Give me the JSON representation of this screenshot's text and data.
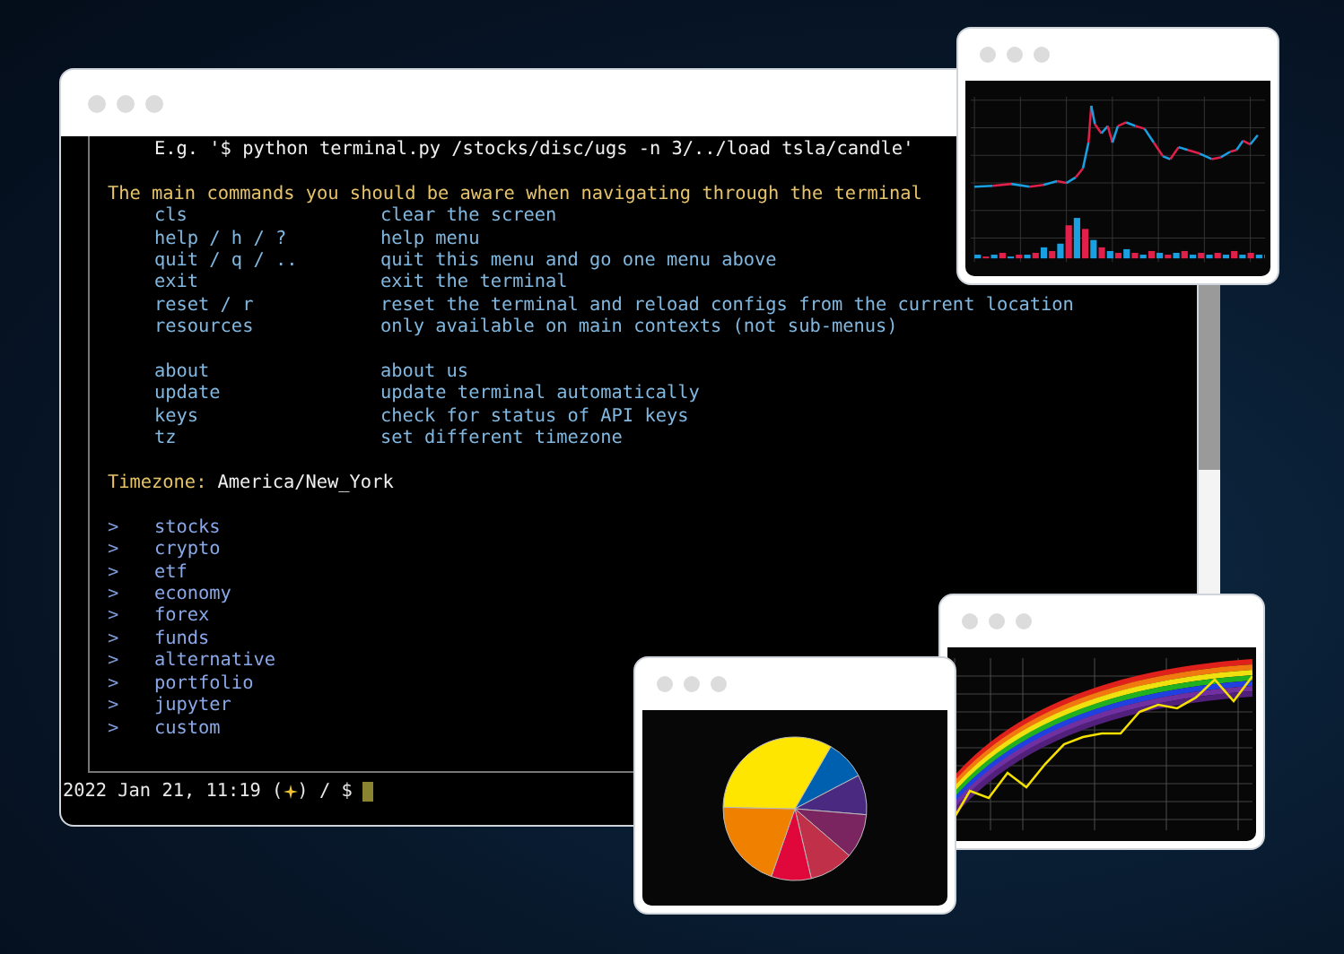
{
  "terminal": {
    "example": "E.g. '$ python terminal.py /stocks/disc/ugs -n 3/../load tsla/candle'",
    "commands_heading": "The main commands you should be aware when navigating through the terminal",
    "command_groups": [
      [
        {
          "command": "cls",
          "description": "clear the screen"
        },
        {
          "command": "help / h / ?",
          "description": "help menu"
        },
        {
          "command": "quit / q / ..",
          "description": "quit this menu and go one menu above"
        },
        {
          "command": "exit",
          "description": "exit the terminal"
        },
        {
          "command": "reset / r",
          "description": "reset the terminal and reload configs from the current location"
        },
        {
          "command": "resources",
          "description": "only available on main contexts (not sub-menus)"
        }
      ],
      [
        {
          "command": "about",
          "description": "about us"
        },
        {
          "command": "update",
          "description": "update terminal automatically"
        },
        {
          "command": "keys",
          "description": "check for status of API keys"
        },
        {
          "command": "tz",
          "description": "set different timezone"
        }
      ]
    ],
    "timezone": {
      "label": "Timezone:",
      "value": "America/New_York"
    },
    "menus": [
      {
        "marker": ">",
        "name": "stocks"
      },
      {
        "marker": ">",
        "name": "crypto"
      },
      {
        "marker": ">",
        "name": "etf"
      },
      {
        "marker": ">",
        "name": "economy"
      },
      {
        "marker": ">",
        "name": "forex"
      },
      {
        "marker": ">",
        "name": "funds"
      },
      {
        "marker": ">",
        "name": "alternative"
      },
      {
        "marker": ">",
        "name": "portfolio"
      },
      {
        "marker": ">",
        "name": "jupyter"
      },
      {
        "marker": ">",
        "name": "custom"
      }
    ],
    "prompt": {
      "before": "2022 Jan 21, 11:19 (",
      "after": ") / $"
    }
  },
  "chart_windows": [
    {
      "kind": "candles"
    },
    {
      "kind": "rainbow"
    },
    {
      "kind": "pie"
    }
  ]
}
